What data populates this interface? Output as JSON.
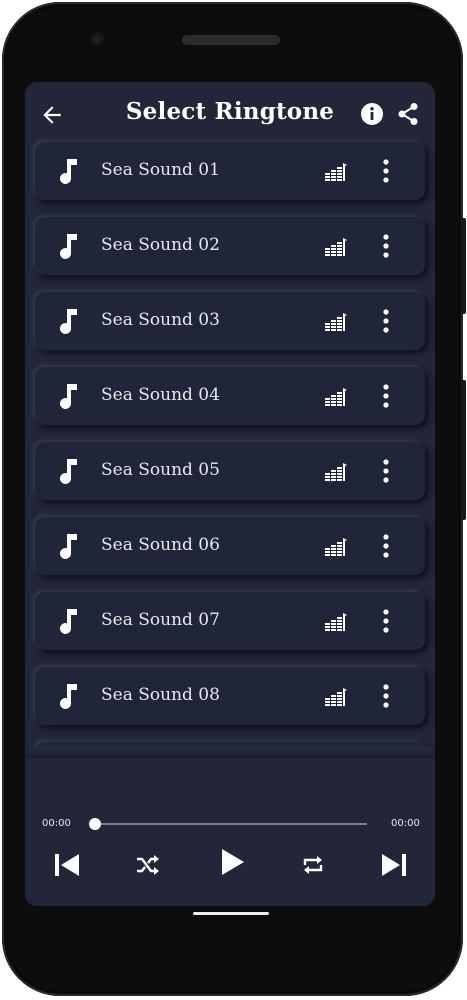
{
  "header": {
    "title": "Select Ringtone",
    "back_icon": "arrow-left-icon",
    "info_icon": "info-icon",
    "share_icon": "share-icon"
  },
  "ringtones": [
    {
      "label": "Sea Sound 01"
    },
    {
      "label": "Sea Sound 02"
    },
    {
      "label": "Sea Sound 03"
    },
    {
      "label": "Sea Sound 04"
    },
    {
      "label": "Sea Sound 05"
    },
    {
      "label": "Sea Sound 06"
    },
    {
      "label": "Sea Sound 07"
    },
    {
      "label": "Sea Sound 08"
    }
  ],
  "row_icons": {
    "leading": "music-note-icon",
    "set_ringtone": "equalizer-icon",
    "more": "more-vertical-icon"
  },
  "player": {
    "current_time": "00:00",
    "total_time": "00:00",
    "progress": 0,
    "controls": [
      "skip-previous-icon",
      "shuffle-icon",
      "play-icon",
      "repeat-icon",
      "skip-next-icon"
    ]
  },
  "colors": {
    "background": "#222638",
    "card": "#21253a",
    "text": "#ffffff"
  }
}
